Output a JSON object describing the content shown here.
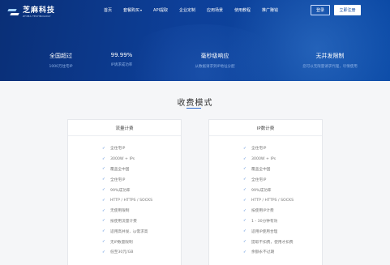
{
  "logo": {
    "title": "芝麻科技",
    "subtitle": "ZHIMA TECHNOLOGY"
  },
  "nav": {
    "items": [
      {
        "label": "首页",
        "dropdown": false
      },
      {
        "label": "套餐购买",
        "dropdown": true
      },
      {
        "label": "API提取",
        "dropdown": false
      },
      {
        "label": "企业定制",
        "dropdown": false
      },
      {
        "label": "应用场景",
        "dropdown": false
      },
      {
        "label": "使用教程",
        "dropdown": false
      },
      {
        "label": "推广赚钱",
        "dropdown": false
      }
    ],
    "login": "登录",
    "register": "立即注册"
  },
  "stats": [
    {
      "value": "全国超过",
      "sub": "1000万住宅IP"
    },
    {
      "value": "99.99%",
      "sub": "IP请求成功率"
    },
    {
      "value": "毫秒级响应",
      "sub": "从数据请求到IP地址分配"
    },
    {
      "value": "无并发限制",
      "sub": "您可以无限量请求代理，尽情使用"
    }
  ],
  "section": {
    "title": "收费模式"
  },
  "cards": [
    {
      "title": "流量计费",
      "features": [
        "全住宅IP",
        "3000W + IPs",
        "覆盖全中国",
        "全住宅IP",
        "99%成功率",
        "HTTP / HTTPS / SOCKS",
        "无使用限制",
        "按使用流量计费",
        "适用高并发、ip需求高",
        "无IP数量限制",
        "低至30元/GB"
      ]
    },
    {
      "title": "IP数计费",
      "features": [
        "全住宅IP",
        "3000W + IPs",
        "覆盖全中国",
        "全住宅IP",
        "99%成功率",
        "HTTP / HTTPS / SOCKS",
        "按使用IP计费",
        "1 - 30分钟有效",
        "适用IP使用合理",
        "提取不扣费，使用才扣费",
        "余额永不过期"
      ]
    }
  ]
}
